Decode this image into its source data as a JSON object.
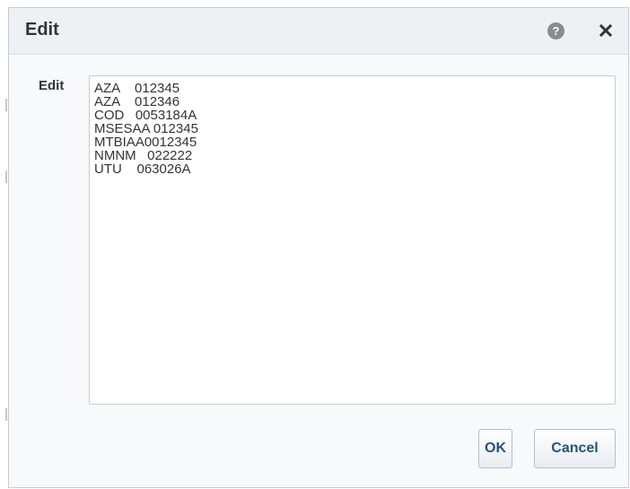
{
  "dialog": {
    "title": "Edit",
    "help_icon": "help-icon",
    "help_glyph": "?",
    "close_icon": "close-icon"
  },
  "form": {
    "field_label": "Edit",
    "textarea_value": "AZA    012345\nAZA    012346\nCOD   0053184A\nMSESAA 012345\nMTBIAA0012345\nNMNM   022222\nUTU    063026A"
  },
  "buttons": {
    "ok_label": "OK",
    "cancel_label": "Cancel"
  },
  "colors": {
    "title_bar_bg": "#eef1f4",
    "dialog_bg": "#f7f9fb",
    "button_text": "#29527a"
  }
}
